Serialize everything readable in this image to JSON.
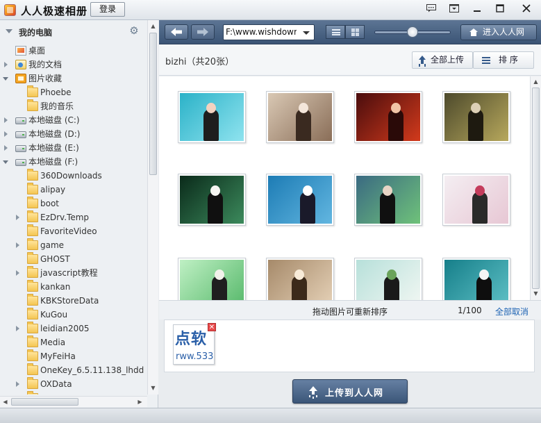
{
  "app": {
    "title": "人人极速相册",
    "login_label": "登录",
    "window_buttons": [
      "chat-icon",
      "menu-icon",
      "minimize-icon",
      "maximize-icon",
      "close-icon"
    ]
  },
  "sidebar": {
    "title": "我的电脑",
    "items": [
      {
        "label": "桌面",
        "icon": "desktop",
        "level": 1,
        "toggle": "none"
      },
      {
        "label": "我的文档",
        "icon": "docs",
        "level": 1,
        "toggle": "collapsed"
      },
      {
        "label": "图片收藏",
        "icon": "pics",
        "level": 1,
        "toggle": "expanded"
      },
      {
        "label": "Phoebe",
        "icon": "folder",
        "level": 2,
        "toggle": "none"
      },
      {
        "label": "我的音乐",
        "icon": "folder",
        "level": 2,
        "toggle": "none"
      },
      {
        "label": "本地磁盘 (C:)",
        "icon": "drive",
        "level": 1,
        "toggle": "collapsed"
      },
      {
        "label": "本地磁盘 (D:)",
        "icon": "drive",
        "level": 1,
        "toggle": "collapsed"
      },
      {
        "label": "本地磁盘 (E:)",
        "icon": "drive",
        "level": 1,
        "toggle": "collapsed"
      },
      {
        "label": "本地磁盘 (F:)",
        "icon": "drive",
        "level": 1,
        "toggle": "expanded"
      },
      {
        "label": "360Downloads",
        "icon": "folder",
        "level": 2,
        "toggle": "none"
      },
      {
        "label": "alipay",
        "icon": "folder",
        "level": 2,
        "toggle": "none"
      },
      {
        "label": "boot",
        "icon": "folder",
        "level": 2,
        "toggle": "none"
      },
      {
        "label": "EzDrv.Temp",
        "icon": "folder",
        "level": 2,
        "toggle": "collapsed"
      },
      {
        "label": "FavoriteVideo",
        "icon": "folder",
        "level": 2,
        "toggle": "none"
      },
      {
        "label": "game",
        "icon": "folder",
        "level": 2,
        "toggle": "collapsed"
      },
      {
        "label": "GHOST",
        "icon": "folder",
        "level": 2,
        "toggle": "none"
      },
      {
        "label": "javascript教程",
        "icon": "folder",
        "level": 2,
        "toggle": "collapsed"
      },
      {
        "label": "kankan",
        "icon": "folder",
        "level": 2,
        "toggle": "none"
      },
      {
        "label": "KBKStoreData",
        "icon": "folder",
        "level": 2,
        "toggle": "none"
      },
      {
        "label": "KuGou",
        "icon": "folder",
        "level": 2,
        "toggle": "none"
      },
      {
        "label": "leidian2005",
        "icon": "folder",
        "level": 2,
        "toggle": "collapsed"
      },
      {
        "label": "Media",
        "icon": "folder",
        "level": 2,
        "toggle": "none"
      },
      {
        "label": "MyFeiHa",
        "icon": "folder",
        "level": 2,
        "toggle": "none"
      },
      {
        "label": "OneKey_6.5.11.138_lhdd",
        "icon": "folder",
        "level": 2,
        "toggle": "none"
      },
      {
        "label": "OXData",
        "icon": "folder",
        "level": 2,
        "toggle": "collapsed"
      },
      {
        "label": "",
        "icon": "folder",
        "level": 2,
        "toggle": "none"
      }
    ]
  },
  "toolbar": {
    "path": "F:\\www.wishdowr",
    "renren_label": "进入人人网"
  },
  "album": {
    "title": "bizhi（共20张）",
    "upload_all_label": "全部上传",
    "sort_label": "排  序"
  },
  "photos": [
    {
      "bg": [
        "#2bb2c8",
        "#8fe3ef"
      ],
      "fig": "#1e1e1e",
      "accent": "#f2d2c0"
    },
    {
      "bg": [
        "#d9c8b4",
        "#8a6e58"
      ],
      "fig": "#3a2a20",
      "accent": "#f4e6da"
    },
    {
      "bg": [
        "#4a0d0d",
        "#d23a1c"
      ],
      "fig": "#2a0a08",
      "accent": "#f1c4a6"
    },
    {
      "bg": [
        "#4d4a2c",
        "#b7a85c"
      ],
      "fig": "#1e1a10",
      "accent": "#ddd0b6"
    },
    {
      "bg": [
        "#0a2a1a",
        "#3c8a5c"
      ],
      "fig": "#101010",
      "accent": "#f6f6f2"
    },
    {
      "bg": [
        "#1d7cb5",
        "#62b6e0"
      ],
      "fig": "#1a1a2a",
      "accent": "#ffffff"
    },
    {
      "bg": [
        "#3a6a82",
        "#6fc27a"
      ],
      "fig": "#101010",
      "accent": "#e8d5c6"
    },
    {
      "bg": [
        "#f4eef2",
        "#e7c7d4"
      ],
      "fig": "#2a2a2a",
      "accent": "#c43c5c"
    },
    {
      "bg": [
        "#bff0c4",
        "#56b86a"
      ],
      "fig": "#1f1f1f",
      "accent": "#f2f2ea"
    },
    {
      "bg": [
        "#a68a6a",
        "#e6d2b8"
      ],
      "fig": "#3c2a1a",
      "accent": "#f8ebd8"
    },
    {
      "bg": [
        "#b7e0da",
        "#f2f7f3"
      ],
      "fig": "#1a1a1a",
      "accent": "#6aa35a"
    },
    {
      "bg": [
        "#167f8a",
        "#5fc1c6"
      ],
      "fig": "#0e0e0e",
      "accent": "#f4f4f4"
    }
  ],
  "status": {
    "drag_hint": "拖动图片可重新排序",
    "count": "1/100",
    "cancel_all": "全部取消"
  },
  "tray": {
    "thumb_logo": "点软",
    "thumb_watermark": "rww.533"
  },
  "upload_button_label": "上传到人人网"
}
